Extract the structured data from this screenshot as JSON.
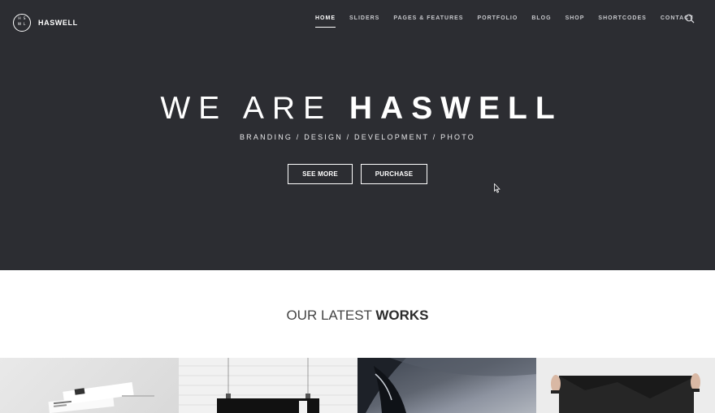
{
  "logo": {
    "mark": [
      "H",
      "S",
      "W",
      "L"
    ],
    "name": "HASWELL"
  },
  "nav": {
    "items": [
      {
        "label": "HOME",
        "active": true
      },
      {
        "label": "SLIDERS",
        "active": false
      },
      {
        "label": "PAGES & FEATURES",
        "active": false
      },
      {
        "label": "PORTFOLIO",
        "active": false
      },
      {
        "label": "BLOG",
        "active": false
      },
      {
        "label": "SHOP",
        "active": false
      },
      {
        "label": "SHORTCODES",
        "active": false
      },
      {
        "label": "CONTACT",
        "active": false
      }
    ],
    "search_icon": "search-icon"
  },
  "hero": {
    "headline_light": "WE ARE",
    "headline_bold": "HASWELL",
    "subline": "BRANDING / DESIGN / DEVELOPMENT / PHOTO",
    "see_more_label": "SEE MORE",
    "purchase_label": "PURCHASE",
    "background_color": "#2c2d32"
  },
  "latest_works": {
    "title_light": "OUR LATEST",
    "title_bold": "WORKS",
    "items": [
      {
        "name": "stationery-mockup"
      },
      {
        "name": "brick-wall-poster"
      },
      {
        "name": "car-headlight"
      },
      {
        "name": "hands-holding-poster"
      }
    ]
  }
}
